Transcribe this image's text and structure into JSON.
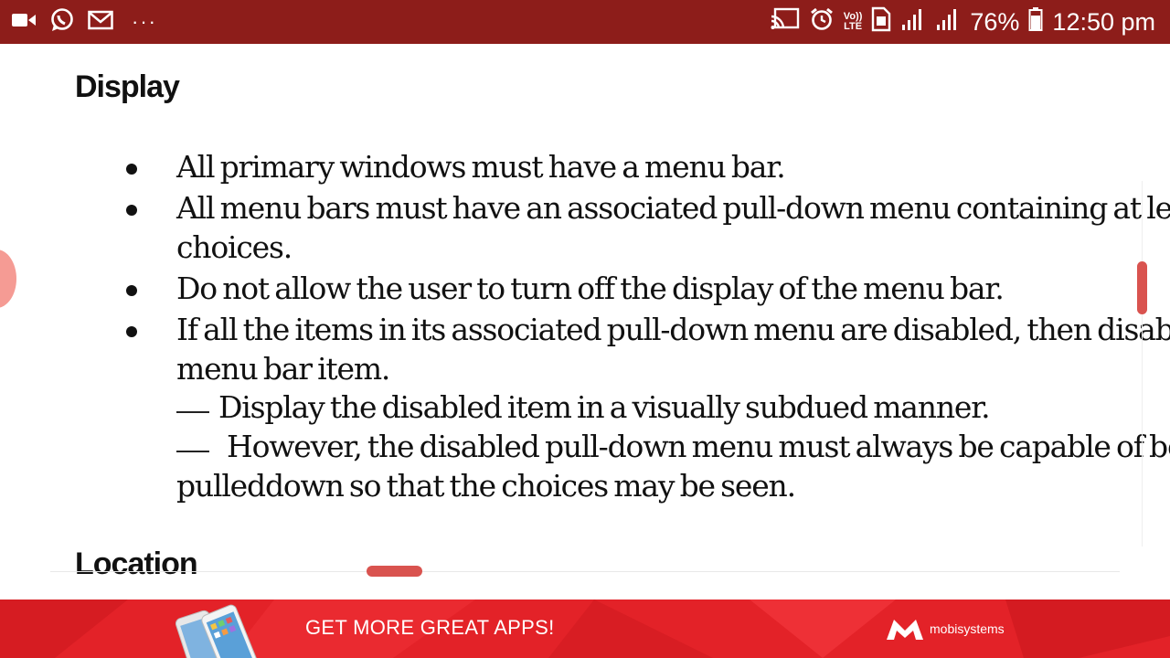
{
  "status_bar": {
    "icons_left": [
      "video-icon",
      "whatsapp-icon",
      "mail-icon",
      "more-icon"
    ],
    "more_dots": "···",
    "icons_right": [
      "cast-icon",
      "alarm-icon",
      "volte-icon",
      "sim-icon",
      "signal-icon",
      "signal-icon",
      "battery-icon"
    ],
    "volte_line1": "Vo))",
    "volte_line2": "LTE",
    "battery": "76%",
    "time": "12:50 pm"
  },
  "document": {
    "section1_title": "Display",
    "bullets": [
      {
        "lines": [
          "All primary windows must have a menu bar."
        ]
      },
      {
        "lines": [
          "All menu bars must have an associated pull-down menu containing at least",
          "choices."
        ]
      },
      {
        "lines": [
          "Do not allow the user to turn off the display of the menu bar."
        ]
      },
      {
        "lines": [
          "If all the items in its associated pull-down menu are disabled, then disable",
          "menu bar item."
        ]
      }
    ],
    "sub_items": [
      {
        "lines": [
          "Display the disabled item in a visually subdued manner."
        ]
      },
      {
        "lines": [
          "However, the disabled pull-down menu must always be capable of  being",
          "pulleddown so that the choices may be seen."
        ]
      }
    ],
    "section2_title": "Location"
  },
  "ad_banner": {
    "text": "GET MORE GREAT APPS!",
    "brand": "mobisystems",
    "colors": {
      "background": "#e32228",
      "text": "#ffffff"
    }
  },
  "colors": {
    "status_bar": "#8d1d1a",
    "scroll_thumb": "#d9534f",
    "page": "#ffffff"
  }
}
